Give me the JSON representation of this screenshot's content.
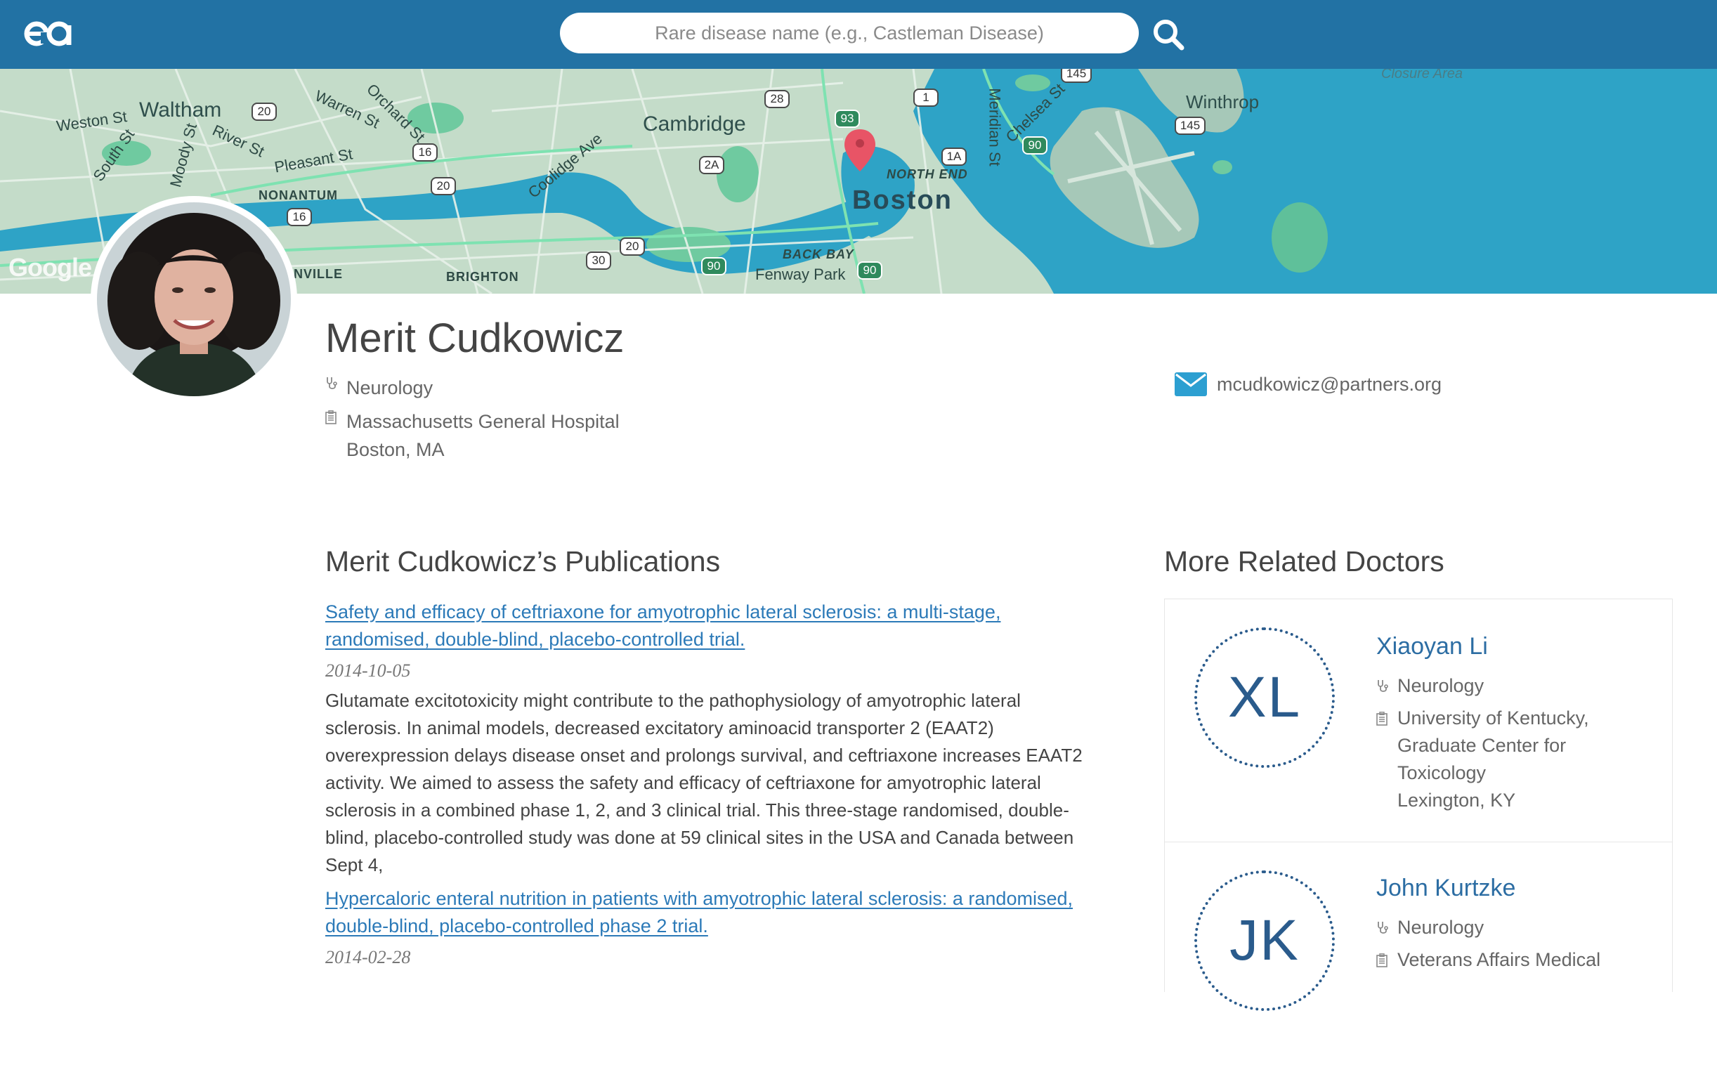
{
  "header": {
    "search_placeholder": "Rare disease name (e.g., Castleman Disease)"
  },
  "map": {
    "labels": {
      "waltham": "Waltham",
      "weston_st": "Weston St",
      "south_st": "South St",
      "moody_st": "Moody St",
      "river_st": "River St",
      "warren_st": "Warren St",
      "orchard_st": "Orchard St",
      "pleasant_st": "Pleasant St",
      "nonantum": "NONANTUM",
      "newtonville": "NVILLE",
      "brighton": "BRIGHTON",
      "cambridge": "Cambridge",
      "coolidge_ave": "Coolidge Ave",
      "boston": "Boston",
      "north_end": "NORTH END",
      "back_bay": "BACK BAY",
      "fenway_park": "Fenway Park",
      "meridian_st": "Meridian St",
      "chelsea_st": "Chelsea St",
      "winthrop": "Winthrop",
      "closure_area": "Closure Area",
      "google": "Google"
    },
    "shields": [
      "20",
      "16",
      "20",
      "16",
      "28",
      "2A",
      "20",
      "30",
      "90",
      "93",
      "1",
      "1A",
      "90",
      "145",
      "145",
      "90"
    ]
  },
  "profile": {
    "name": "Merit Cudkowicz",
    "specialty": "Neurology",
    "hospital": "Massachusetts General Hospital",
    "location": "Boston, MA",
    "email": "mcudkowicz@partners.org"
  },
  "publications": {
    "heading": "Merit Cudkowicz’s Publications",
    "items": [
      {
        "title": "Safety and efficacy of ceftriaxone for amyotrophic lateral sclerosis: a multi-stage, randomised, double-blind, placebo-controlled trial.",
        "date": "2014-10-05",
        "abstract": "Glutamate excitotoxicity might contribute to the pathophysiology of amyotrophic lateral sclerosis. In animal models, decreased excitatory aminoacid transporter 2 (EAAT2) overexpression delays disease onset and prolongs survival, and ceftriaxone increases EAAT2 activity. We aimed to assess the safety and efficacy of ceftriaxone for amyotrophic lateral sclerosis in a combined phase 1, 2, and 3 clinical trial. This three-stage randomised, double-blind, placebo-controlled study was done at 59 clinical sites in the USA and Canada between Sept 4,"
      },
      {
        "title": "Hypercaloric enteral nutrition in patients with amyotrophic lateral sclerosis: a randomised, double-blind, placebo-controlled phase 2 trial.",
        "date": "2014-02-28"
      }
    ]
  },
  "related": {
    "heading": "More Related Doctors",
    "doctors": [
      {
        "initials": "XL",
        "name": "Xiaoyan Li",
        "specialty": "Neurology",
        "hospital_lines": [
          "University of Kentucky,",
          "Graduate Center for",
          "Toxicology"
        ],
        "location": "Lexington, KY"
      },
      {
        "initials": "JK",
        "name": "John Kurtzke",
        "specialty": "Neurology",
        "hospital_lines": [
          "Veterans Affairs Medical"
        ]
      }
    ]
  },
  "colors": {
    "header_bg": "#2272a4",
    "link": "#2c7ab8",
    "map_land": "#c4dcc9",
    "map_water": "#2ea3c6",
    "map_park": "#6fcaa0",
    "pin": "#e85466"
  }
}
